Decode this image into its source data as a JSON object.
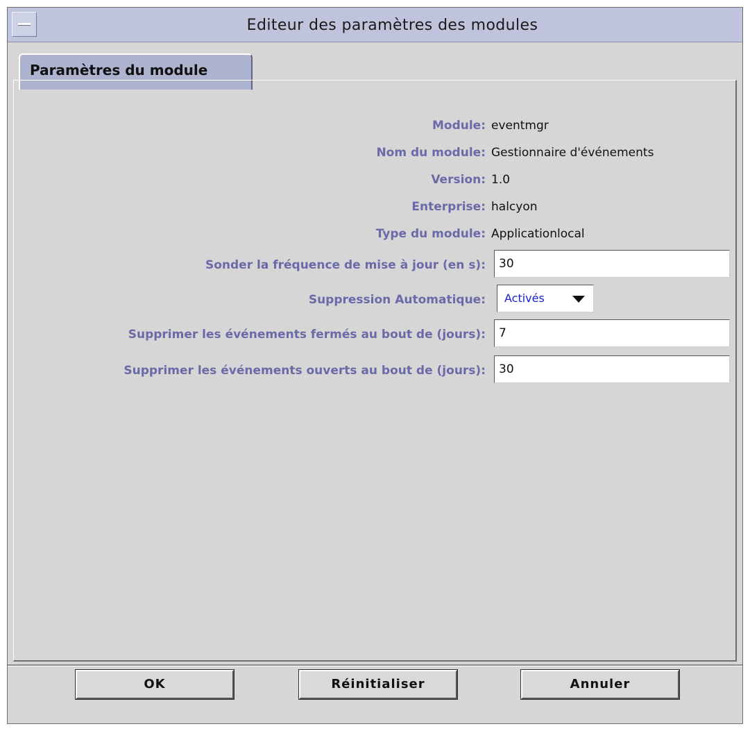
{
  "window": {
    "title": "Editeur des paramètres des modules"
  },
  "tabs": [
    {
      "label": "Paramètres du module"
    }
  ],
  "info": [
    {
      "label": "Module:",
      "value": "eventmgr"
    },
    {
      "label": "Nom du module:",
      "value": "Gestionnaire d'événements"
    },
    {
      "label": "Version:",
      "value": "1.0"
    },
    {
      "label": "Enterprise:",
      "value": "halcyon"
    },
    {
      "label": "Type du module:",
      "value": "Applicationlocal"
    }
  ],
  "fields": {
    "poll": {
      "label": "Sonder la fréquence de mise à jour (en s):",
      "value": "30"
    },
    "auto_delete": {
      "label": "Suppression Automatique:",
      "value": "Activés"
    },
    "closed_days": {
      "label": "Supprimer les événements fermés au bout de (jours):",
      "value": "7"
    },
    "open_days": {
      "label": "Supprimer les événements ouverts au bout de (jours):",
      "value": "30"
    }
  },
  "buttons": {
    "ok": "OK",
    "reset": "Réinitialiser",
    "cancel": "Annuler"
  },
  "icons": {
    "window_menu": "window-menu-icon",
    "dropdown": "chevron-down-icon"
  }
}
